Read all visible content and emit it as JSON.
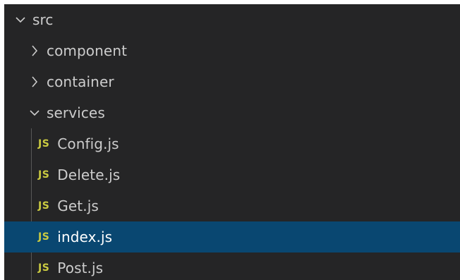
{
  "explorer": {
    "root": {
      "label": "src",
      "expanded": true
    },
    "folders": [
      {
        "label": "component",
        "expanded": false
      },
      {
        "label": "container",
        "expanded": false
      },
      {
        "label": "services",
        "expanded": true
      }
    ],
    "files": [
      {
        "icon": "JS",
        "label": "Config.js",
        "selected": false
      },
      {
        "icon": "JS",
        "label": "Delete.js",
        "selected": false
      },
      {
        "icon": "JS",
        "label": "Get.js",
        "selected": false
      },
      {
        "icon": "JS",
        "label": "index.js",
        "selected": true
      },
      {
        "icon": "JS",
        "label": "Post.js",
        "selected": false
      }
    ],
    "colors": {
      "background": "#252526",
      "text": "#cccccc",
      "selected_background": "#094771",
      "js_icon": "#cbcb41",
      "indent_guide": "#585858"
    }
  }
}
